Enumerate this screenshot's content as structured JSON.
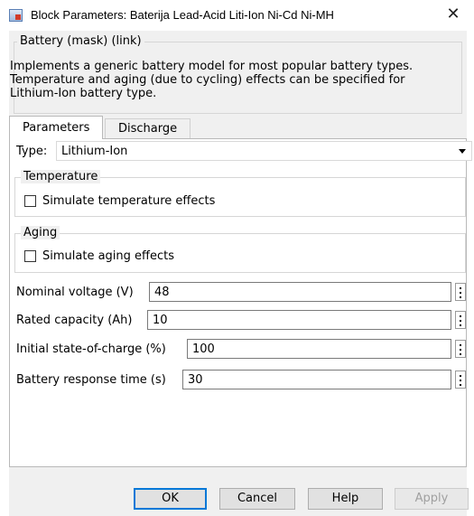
{
  "window": {
    "title": "Block Parameters: Baterija Lead-Acid Liti-Ion Ni-Cd Ni-MH",
    "close_icon": "close-icon",
    "app_icon": "simulink-block-icon"
  },
  "mask": {
    "header": "Battery (mask) (link)",
    "description_lines": [
      "Implements a generic battery model for most popular battery types.",
      "Temperature and aging (due to cycling) effects can be specified for",
      "Lithium-Ion battery type."
    ]
  },
  "tabs": [
    {
      "label": "Parameters",
      "active": true
    },
    {
      "label": "Discharge",
      "active": false
    }
  ],
  "type_select": {
    "label": "Type:",
    "value": "Lithium-Ion"
  },
  "temperature": {
    "legend": "Temperature",
    "checkbox_label": "Simulate temperature effects",
    "checked": false
  },
  "aging": {
    "legend": "Aging",
    "checkbox_label": "Simulate aging effects",
    "checked": false
  },
  "params": [
    {
      "label": "Nominal voltage (V)",
      "value": "48"
    },
    {
      "label": "Rated capacity (Ah)",
      "value": "10"
    },
    {
      "label": "Initial state-of-charge (%)",
      "value": "100"
    },
    {
      "label": "Battery response time (s)",
      "value": "30"
    }
  ],
  "buttons": {
    "ok": "OK",
    "cancel": "Cancel",
    "help": "Help",
    "apply": "Apply",
    "apply_enabled": false
  },
  "colors": {
    "default_button_border": "#0078d7",
    "dialog_bg": "#f0f0f0"
  }
}
